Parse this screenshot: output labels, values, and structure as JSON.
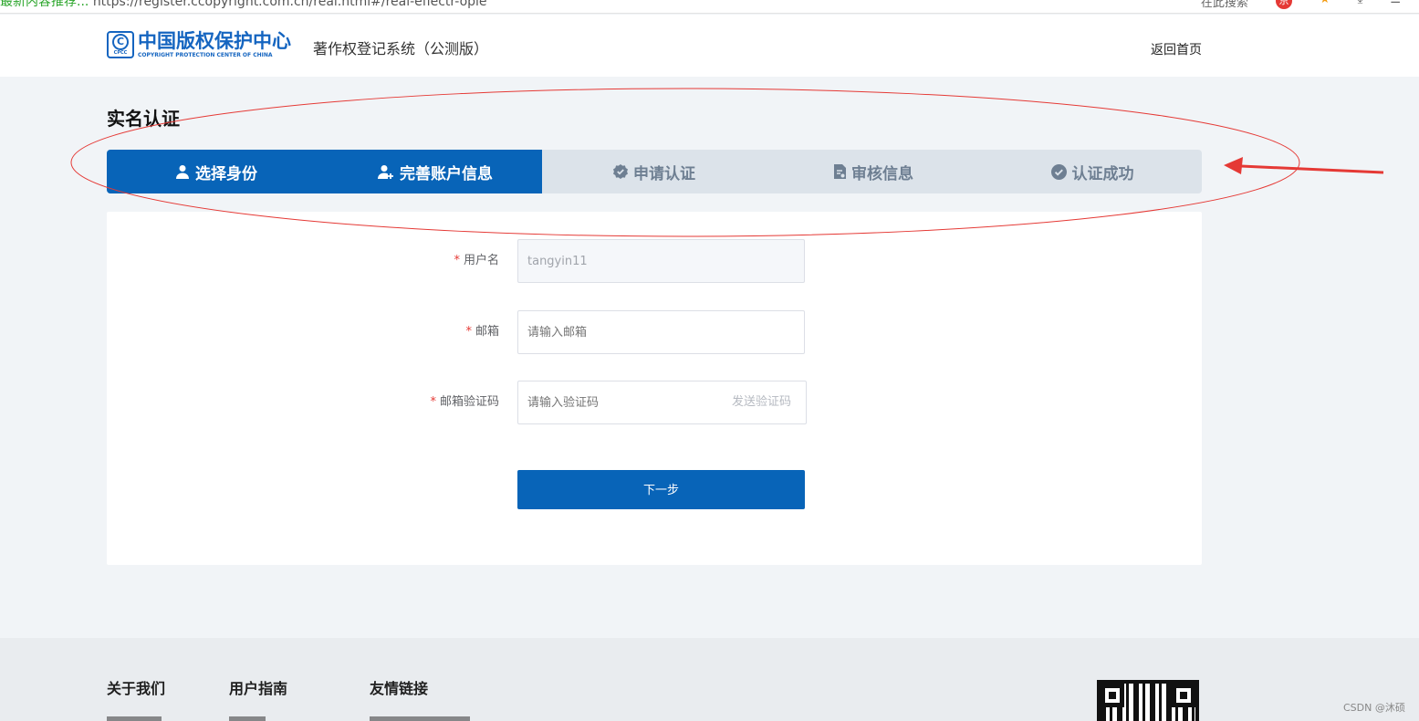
{
  "browser": {
    "url_prefix": "最新内容推荐...",
    "url": "https://register.ccopyright.com.cn/real.html#/real-eflectr-ople",
    "search_hint": "在此搜索"
  },
  "header": {
    "logo_cn": "中国版权保护中心",
    "logo_en": "COPYRIGHT PROTECTION CENTER OF CHINA",
    "logo_abbr": "CPCC",
    "system_title": "著作权登记系统（公测版）",
    "home_link": "返回首页"
  },
  "page_title": "实名认证",
  "steps": [
    {
      "label": "选择身份",
      "icon": "user-icon",
      "active": true
    },
    {
      "label": "完善账户信息",
      "icon": "user-add-icon",
      "active": true
    },
    {
      "label": "申请认证",
      "icon": "badge-check-icon",
      "active": false
    },
    {
      "label": "审核信息",
      "icon": "document-icon",
      "active": false
    },
    {
      "label": "认证成功",
      "icon": "circle-check-icon",
      "active": false
    }
  ],
  "form": {
    "username": {
      "label": "用户名",
      "value": "tangyin11"
    },
    "email": {
      "label": "邮箱",
      "placeholder": "请输入邮箱"
    },
    "code": {
      "label": "邮箱验证码",
      "placeholder": "请输入验证码",
      "send_label": "发送验证码"
    },
    "next_button": "下一步",
    "required_mark": "*"
  },
  "footer": {
    "columns": [
      "关于我们",
      "用户指南",
      "友情链接"
    ]
  },
  "watermark": "CSDN @沐硕",
  "colors": {
    "primary": "#0864b8",
    "steps_inactive_bg": "#dce3ea",
    "annotation_red": "#e53935",
    "page_bg": "#f1f4f7"
  }
}
